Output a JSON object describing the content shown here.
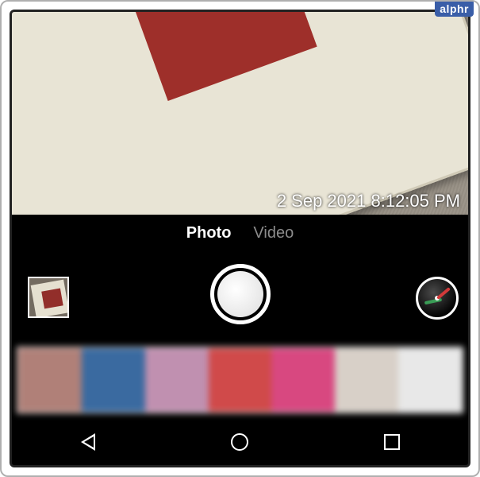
{
  "watermark": "alphr",
  "timestamp": "2 Sep 2021 8:12:05 PM",
  "modes": {
    "photo": "Photo",
    "video": "Video",
    "active": "photo"
  },
  "icons": {
    "last_photo_thumb": "last-photo-thumbnail",
    "shutter": "shutter-button",
    "settings_dial": "settings-dial",
    "back": "back-icon",
    "home": "home-icon",
    "recent": "recent-apps-icon"
  },
  "gallery_colors": [
    "#b08078",
    "#3a6aa0",
    "#c090b0",
    "#d04a4a",
    "#d84880",
    "#d8d0c8",
    "#e8e8e8"
  ]
}
